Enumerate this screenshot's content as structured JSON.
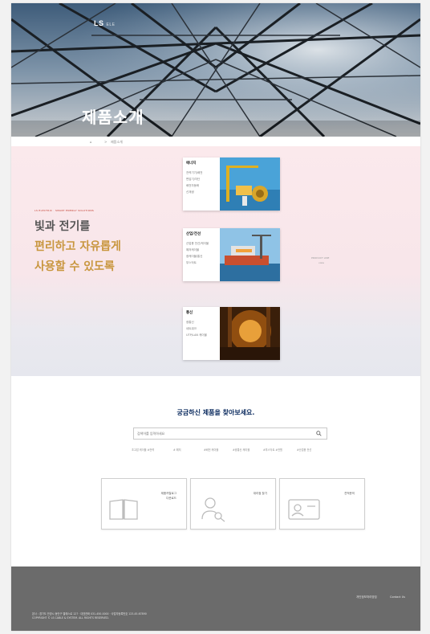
{
  "header": {
    "logo": "LS",
    "logo_sub": "ELE",
    "title": "제품소개"
  },
  "breadcrumb": {
    "home": "⌂",
    "sep": ">",
    "current": "제품소개"
  },
  "hero_section": {
    "tagline_small": "LS ELECTRIC · SMART ENERGY SOLUTIONS",
    "slogan_line1": "빛과 전기를",
    "slogan_line2": "편리하고 자유롭게",
    "slogan_line3": "사용할 수 있도록",
    "side_label_1": "PRODUCT LINE",
    "side_label_2": "view"
  },
  "product_cards": [
    {
      "title": "에너지",
      "items": [
        "전력기기/배전",
        "변압기/차단",
        "배전자동화",
        "신재생"
      ]
    },
    {
      "title": "산업/전선",
      "items": [
        "산업용 전선/케이블",
        "해저케이블",
        "광케이블/통신",
        "부스닥트"
      ]
    },
    {
      "title": "통신",
      "items": [
        "광통신",
        "네트워크",
        "UTP/LAN 케이블"
      ]
    }
  ],
  "search": {
    "title": "궁금하신 제품을 찾아보세요.",
    "placeholder": "검색어를 입력하세요",
    "tags": [
      "초고압 케이블 #전력",
      "# 해저",
      "#배전 케이블",
      "#광통신 케이블",
      "#부스닥트 #전원",
      "#산업용 전선"
    ]
  },
  "quick_cards": [
    {
      "label_1": "제품카탈로그",
      "label_2": "다운로드"
    },
    {
      "label_1": "대리점 찾기",
      "label_2": ""
    },
    {
      "label_1": "견적문의",
      "label_2": ""
    }
  ],
  "footer": {
    "link_1": "개인정보처리방침",
    "link_2": "Contact Us",
    "info_1": "본사 : 경기도 안양시 동안구 엘에스로 127 · 대표전화 031-450-0000 · 사업자등록번호 123-45-67890",
    "info_2": "COPYRIGHT © LS CABLE & SYSTEM. ALL RIGHTS RESERVED."
  },
  "colors": {
    "accent_gold": "#c8963e",
    "navy": "#0a2a5e",
    "footer_bg": "#6b6b6b"
  }
}
